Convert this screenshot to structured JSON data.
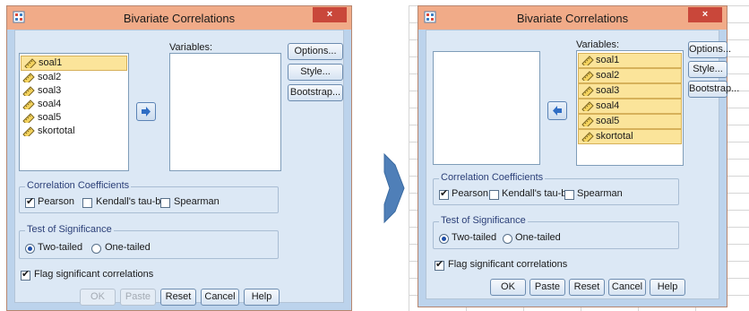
{
  "left_dialog": {
    "title": "Bivariate Correlations",
    "close_label": "×",
    "source_items": [
      "soal1",
      "soal2",
      "soal3",
      "soal4",
      "soal5",
      "skortotal"
    ],
    "variables_label": "Variables:",
    "target_items": [],
    "buttons": {
      "options": "Options...",
      "style": "Style...",
      "bootstrap": "Bootstrap..."
    },
    "correlation_group": {
      "title": "Correlation Coefficients",
      "pearson": "Pearson",
      "pearson_checked": true,
      "kendall": "Kendall's tau-b",
      "kendall_checked": false,
      "spearman": "Spearman",
      "spearman_checked": false
    },
    "significance_group": {
      "title": "Test of Significance",
      "two_tailed": "Two-tailed",
      "one_tailed": "One-tailed",
      "selected": "two_tailed"
    },
    "flag_label": "Flag significant correlations",
    "flag_checked": true,
    "bottom_buttons": {
      "ok": "OK",
      "paste": "Paste",
      "reset": "Reset",
      "cancel": "Cancel",
      "help": "Help"
    }
  },
  "right_dialog": {
    "title": "Bivariate Correlations",
    "close_label": "×",
    "source_items": [],
    "variables_label": "Variables:",
    "target_items": [
      "soal1",
      "soal2",
      "soal3",
      "soal4",
      "soal5",
      "skortotal"
    ],
    "buttons": {
      "options": "Options...",
      "style": "Style...",
      "bootstrap": "Bootstrap..."
    },
    "correlation_group": {
      "title": "Correlation Coefficients",
      "pearson": "Pearson",
      "pearson_checked": true,
      "kendall": "Kendall's tau-b",
      "kendall_checked": false,
      "spearman": "Spearman",
      "spearman_checked": false
    },
    "significance_group": {
      "title": "Test of Significance",
      "two_tailed": "Two-tailed",
      "one_tailed": "One-tailed",
      "selected": "two_tailed"
    },
    "flag_label": "Flag significant correlations",
    "flag_checked": true,
    "bottom_buttons": {
      "ok": "OK",
      "paste": "Paste",
      "reset": "Reset",
      "cancel": "Cancel",
      "help": "Help"
    }
  },
  "colors": {
    "transition_arrow": "#4f7fb8",
    "titlebar": "#f1ab88",
    "dialog_bg": "#dce8f5",
    "selection": "#fbe49a"
  },
  "icons": {
    "move_right": "arrow-right-icon",
    "move_left": "arrow-left-icon",
    "variable": "ruler-scale-icon"
  }
}
